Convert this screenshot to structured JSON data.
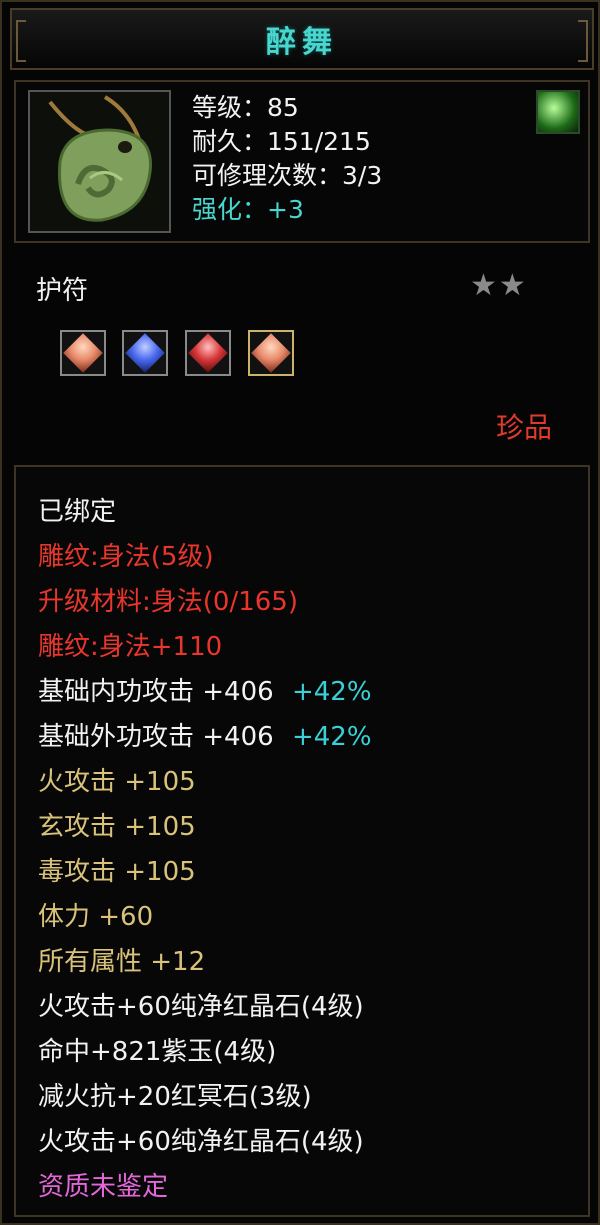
{
  "item": {
    "name": "醉舞",
    "level": "等级：85",
    "durability": "耐久：151/215",
    "repairs": "可修理次数：3/3",
    "enhance": "强化：+3",
    "type": "护符",
    "stars": "★★",
    "rarity": "珍品",
    "icon": "jade-amulet-icon",
    "badge_icon": "leaf-icon"
  },
  "gems": [
    {
      "icon": "gem-orange-icon",
      "color": "#e88a6a"
    },
    {
      "icon": "gem-blue-icon",
      "color": "#4a6af0"
    },
    {
      "icon": "gem-red-icon",
      "color": "#d8383a"
    },
    {
      "icon": "gem-orange-icon",
      "color": "#e88a6a"
    }
  ],
  "attrs": {
    "bound": "已绑定",
    "carve": "雕纹:身法(5级)",
    "upgrade": "升级材料:身法(0/165)",
    "carve_bonus": "雕纹:身法+110",
    "inner_atk": "基础内功攻击  +406",
    "inner_pct": "+42%",
    "outer_atk": "基础外功攻击  +406",
    "outer_pct": "+42%",
    "fire_atk": "火攻击  +105",
    "xuan_atk": "玄攻击  +105",
    "poison_atk": "毒攻击  +105",
    "stamina": "体力  +60",
    "all_attr": "所有属性  +12",
    "socket1": "火攻击+60纯净红晶石(4级)",
    "socket2": "命中+821紫玉(4级)",
    "socket3": "减火抗+20红冥石(3级)",
    "socket4": "火攻击+60纯净红晶石(4级)",
    "quality": "资质未鉴定"
  },
  "colors": {
    "title": "#49d6cf",
    "red": "#e8362c",
    "gold": "#d9c27a",
    "cyan": "#3ad0d8",
    "magenta": "#e267d8"
  }
}
